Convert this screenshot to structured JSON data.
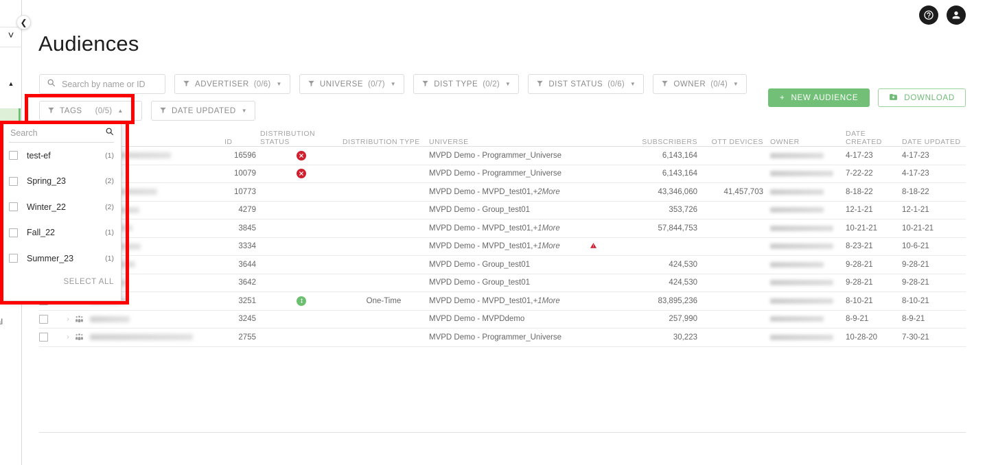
{
  "app": {
    "page_title": "Audiences"
  },
  "topbar": {
    "help_icon": "help-circle-icon",
    "account_icon": "account-circle-icon"
  },
  "sidebar": {
    "collapse_icon": "chevron-left-icon",
    "expand_icon": "chevron-down-icon",
    "collapse_up_icon": "chevron-up-icon",
    "partial_label": "rnal"
  },
  "search": {
    "placeholder": "Search by name or ID",
    "value": "",
    "icon": "search-icon"
  },
  "filters": [
    {
      "label": "ADVERTISER",
      "count": "(0/6)",
      "icon": "filter-funnel-icon",
      "caret": "caret-down-icon",
      "open": false
    },
    {
      "label": "UNIVERSE",
      "count": "(0/7)",
      "icon": "filter-funnel-icon",
      "caret": "caret-down-icon",
      "open": false
    },
    {
      "label": "DIST TYPE",
      "count": "(0/2)",
      "icon": "filter-funnel-icon",
      "caret": "caret-down-icon",
      "open": false
    },
    {
      "label": "DIST STATUS",
      "count": "(0/6)",
      "icon": "filter-funnel-icon",
      "caret": "caret-down-icon",
      "open": false
    },
    {
      "label": "OWNER",
      "count": "(0/4)",
      "icon": "filter-funnel-icon",
      "caret": "caret-down-icon",
      "open": false
    }
  ],
  "filters_row2": [
    {
      "label": "TAGS",
      "count": "(0/5)",
      "icon": "filter-funnel-icon",
      "caret": "caret-up-icon",
      "open": true
    },
    {
      "label": "DATE UPDATED",
      "count": "",
      "icon": "filter-funnel-icon",
      "caret": "caret-down-icon",
      "open": false
    }
  ],
  "actions": {
    "new_audience_label": "NEW AUDIENCE",
    "new_audience_icon": "plus-icon",
    "download_label": "DOWNLOAD",
    "download_icon": "download-folder-icon",
    "primary_color": "#72c077"
  },
  "tags_dropdown": {
    "search_placeholder": "Search",
    "search_value": "",
    "search_icon": "search-icon",
    "select_all_label": "SELECT ALL",
    "items": [
      {
        "label": "test-ef",
        "count": "(1)",
        "checked": false
      },
      {
        "label": "Spring_23",
        "count": "(2)",
        "checked": false
      },
      {
        "label": "Winter_22",
        "count": "(2)",
        "checked": false
      },
      {
        "label": "Fall_22",
        "count": "(1)",
        "checked": false
      },
      {
        "label": "Summer_23",
        "count": "(1)",
        "checked": false
      }
    ]
  },
  "table": {
    "columns": [
      "ID",
      "DISTRIBUTION STATUS",
      "DISTRIBUTION TYPE",
      "UNIVERSE",
      "SUBSCRIBERS",
      "OTT DEVICES",
      "OWNER",
      "DATE CREATED",
      "DATE UPDATED"
    ],
    "row_icon": "audience-group-icon",
    "expand_icon": "chevron-right-icon",
    "checkbox_icon": "checkbox-unchecked-icon",
    "rows": [
      {
        "id": "16596",
        "dist_status": "error",
        "dist_type": "",
        "universe": "MVPD Demo - Programmer_Universe",
        "universe_more": "",
        "warning": false,
        "subscribers": "6,143,164",
        "ott_devices": "",
        "date_created": "4-17-23",
        "date_updated": "4-17-23"
      },
      {
        "id": "10079",
        "dist_status": "error",
        "dist_type": "",
        "universe": "MVPD Demo - Programmer_Universe",
        "universe_more": "",
        "warning": false,
        "subscribers": "6,143,164",
        "ott_devices": "",
        "date_created": "7-22-22",
        "date_updated": "4-17-23"
      },
      {
        "id": "10773",
        "dist_status": "",
        "dist_type": "",
        "universe": "MVPD Demo - MVPD_test01,",
        "universe_more": "+2More",
        "warning": false,
        "subscribers": "43,346,060",
        "ott_devices": "41,457,703",
        "date_created": "8-18-22",
        "date_updated": "8-18-22"
      },
      {
        "id": "4279",
        "dist_status": "",
        "dist_type": "",
        "universe": "MVPD Demo - Group_test01",
        "universe_more": "",
        "warning": false,
        "subscribers": "353,726",
        "ott_devices": "",
        "date_created": "12-1-21",
        "date_updated": "12-1-21"
      },
      {
        "id": "3845",
        "dist_status": "",
        "dist_type": "",
        "universe": "MVPD Demo - MVPD_test01,",
        "universe_more": "+1More",
        "warning": false,
        "subscribers": "57,844,753",
        "ott_devices": "",
        "date_created": "10-21-21",
        "date_updated": "10-21-21"
      },
      {
        "id": "3334",
        "dist_status": "",
        "dist_type": "",
        "universe": "MVPD Demo - MVPD_test01,",
        "universe_more": "+1More",
        "warning": true,
        "subscribers": "",
        "ott_devices": "",
        "date_created": "8-23-21",
        "date_updated": "10-6-21"
      },
      {
        "id": "3644",
        "dist_status": "",
        "dist_type": "",
        "universe": "MVPD Demo - Group_test01",
        "universe_more": "",
        "warning": false,
        "subscribers": "424,530",
        "ott_devices": "",
        "date_created": "9-28-21",
        "date_updated": "9-28-21"
      },
      {
        "id": "3642",
        "dist_status": "",
        "dist_type": "",
        "universe": "MVPD Demo - Group_test01",
        "universe_more": "",
        "warning": false,
        "subscribers": "424,530",
        "ott_devices": "",
        "date_created": "9-28-21",
        "date_updated": "9-28-21"
      },
      {
        "id": "3251",
        "dist_status": "ok",
        "dist_type": "One-Time",
        "universe": "MVPD Demo - MVPD_test01,",
        "universe_more": "+1More",
        "warning": false,
        "subscribers": "83,895,236",
        "ott_devices": "",
        "date_created": "8-10-21",
        "date_updated": "8-10-21"
      },
      {
        "id": "3245",
        "dist_status": "",
        "dist_type": "",
        "universe": "MVPD Demo - MVPDdemo",
        "universe_more": "",
        "warning": false,
        "subscribers": "257,990",
        "ott_devices": "",
        "date_created": "8-9-21",
        "date_updated": "8-9-21"
      },
      {
        "id": "2755",
        "dist_status": "",
        "dist_type": "",
        "universe": "MVPD Demo - Programmer_Universe",
        "universe_more": "",
        "warning": false,
        "subscribers": "30,223",
        "ott_devices": "",
        "date_created": "10-28-20",
        "date_updated": "7-30-21"
      }
    ]
  },
  "annotations": {
    "highlight_color": "#ff0000"
  }
}
